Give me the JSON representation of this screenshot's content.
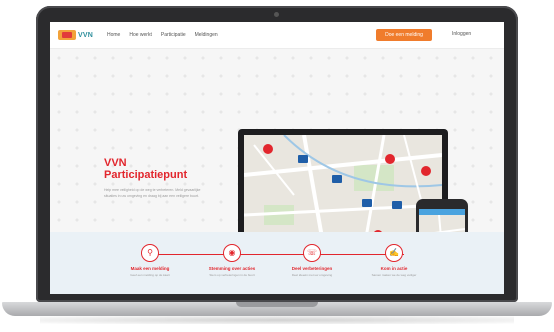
{
  "header": {
    "logo_text": "VVN",
    "nav": [
      "Home",
      "Hoe werkt",
      "Participatie",
      "Meldingen"
    ],
    "cta_label": "Doe een melding",
    "login_label": "Inloggen"
  },
  "hero": {
    "title_line1": "VVN",
    "title_line2": "Participatiepunt",
    "text": "Help mee veiligheid op de weg te verbeteren. Meld gevaarlijke situaties in uw omgeving en draag bij aan een veiligere buurt."
  },
  "steps": [
    {
      "icon": "location-pin-icon",
      "glyph": "⚲",
      "title": "Maak een melding",
      "sub": "Geef een melding op de kaart"
    },
    {
      "icon": "target-icon",
      "glyph": "◉",
      "title": "Stemming over acties",
      "sub": "Stem op verbeteringen in de buurt"
    },
    {
      "icon": "chat-icon",
      "glyph": "☏",
      "title": "Deel verbeteringen",
      "sub": "Deel ideeën met uw omgeving"
    },
    {
      "icon": "thumbs-up-icon",
      "glyph": "✍",
      "title": "Kom in actie",
      "sub": "Samen maken we de weg veiliger"
    }
  ],
  "colors": {
    "accent_red": "#e2262d",
    "cta_orange": "#f07c2c",
    "logo_teal": "#2f8f9d",
    "steps_bg": "#eaf1f6"
  }
}
